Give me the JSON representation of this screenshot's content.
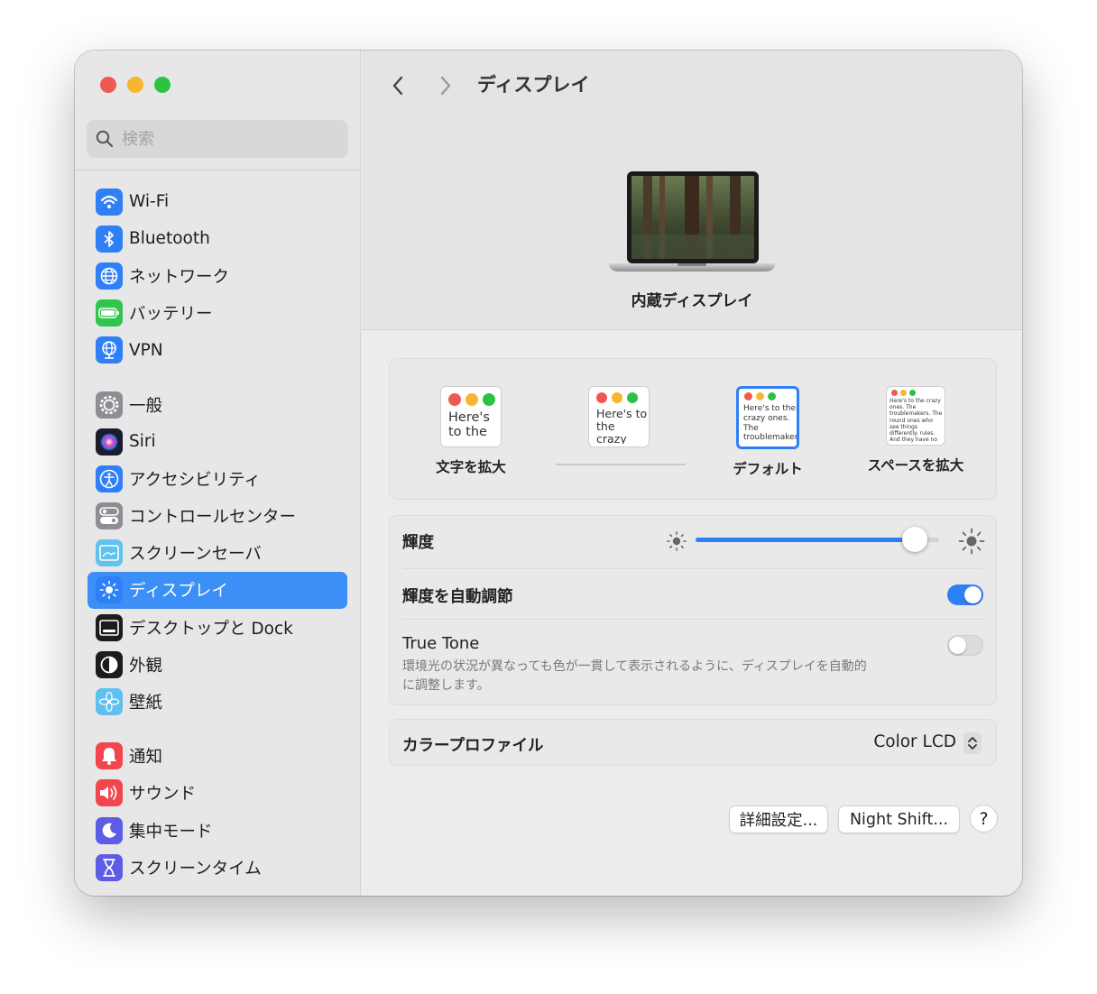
{
  "window": {
    "traffic_lights": {
      "close": "#ee5a52",
      "minimize": "#f5b72d",
      "zoom": "#2ec244"
    }
  },
  "search": {
    "placeholder": "検索",
    "value": ""
  },
  "sidebar": {
    "groups": [
      [
        {
          "label": "Wi-Fi",
          "icon": "wifi-icon",
          "color": "#2f7ff6"
        },
        {
          "label": "Bluetooth",
          "icon": "bluetooth-icon",
          "color": "#2f7ff6"
        },
        {
          "label": "ネットワーク",
          "icon": "globe-icon",
          "color": "#2f7ff6"
        },
        {
          "label": "バッテリー",
          "icon": "battery-icon",
          "color": "#30c64c"
        },
        {
          "label": "VPN",
          "icon": "vpn-globe-icon",
          "color": "#2f7ff6"
        }
      ],
      [
        {
          "label": "一般",
          "icon": "gear-icon",
          "color": "#8d8d93"
        },
        {
          "label": "Siri",
          "icon": "siri-icon",
          "color": "#1b1b2e"
        },
        {
          "label": "アクセシビリティ",
          "icon": "accessibility-icon",
          "color": "#2f7ff6"
        },
        {
          "label": "コントロールセンター",
          "icon": "control-center-icon",
          "color": "#8d8d93"
        },
        {
          "label": "スクリーンセーバ",
          "icon": "screensaver-icon",
          "color": "#60c3ef"
        },
        {
          "label": "ディスプレイ",
          "icon": "display-sun-icon",
          "color": "#2f7ff6",
          "selected": true
        },
        {
          "label": "デスクトップと Dock",
          "icon": "dock-icon",
          "color": "#1c1c1e"
        },
        {
          "label": "外観",
          "icon": "appearance-icon",
          "color": "#1c1c1e"
        },
        {
          "label": "壁紙",
          "icon": "wallpaper-flower-icon",
          "color": "#5fc0f0"
        }
      ],
      [
        {
          "label": "通知",
          "icon": "bell-icon",
          "color": "#f2464f"
        },
        {
          "label": "サウンド",
          "icon": "speaker-icon",
          "color": "#f2464f"
        },
        {
          "label": "集中モード",
          "icon": "moon-icon",
          "color": "#5e5ce6"
        },
        {
          "label": "スクリーンタイム",
          "icon": "hourglass-icon",
          "color": "#5e5ce6"
        }
      ]
    ]
  },
  "header": {
    "title": "ディスプレイ",
    "back_icon": "chevron-left-icon",
    "forward_icon": "chevron-right-icon"
  },
  "display": {
    "name": "内蔵ディスプレイ"
  },
  "resolution": {
    "options": [
      {
        "label": "文字を拡大",
        "sample": "Here's to the crazy ones. The troublemakers."
      },
      {
        "label": "",
        "sample": "Here's to the crazy ones. The troublemakers. The ones who"
      },
      {
        "label": "デフォルト",
        "sample": "Here's to the crazy ones. The troublemakers. The ones who see things differently. rules. And they",
        "selected": true
      },
      {
        "label": "スペースを拡大",
        "sample": "Here's to the crazy ones. The troublemakers. The round ones who see things differently. rules. And they have no can quote them, disagree them. About the only th Because they change t"
      }
    ]
  },
  "brightness": {
    "label": "輝度",
    "level": 0.9
  },
  "auto_brightness": {
    "label": "輝度を自動調節",
    "on": true
  },
  "true_tone": {
    "label": "True Tone",
    "description_line1": "環境光の状況が異なっても色が一貫して表示されるように、ディスプレイを自動的",
    "description_line2": "に調整します。",
    "on": false
  },
  "color_profile": {
    "label": "カラープロファイル",
    "value": "Color LCD"
  },
  "buttons": {
    "advanced": "詳細設定...",
    "night_shift": "Night Shift...",
    "help": "?"
  },
  "accent": "#2f7ff6"
}
